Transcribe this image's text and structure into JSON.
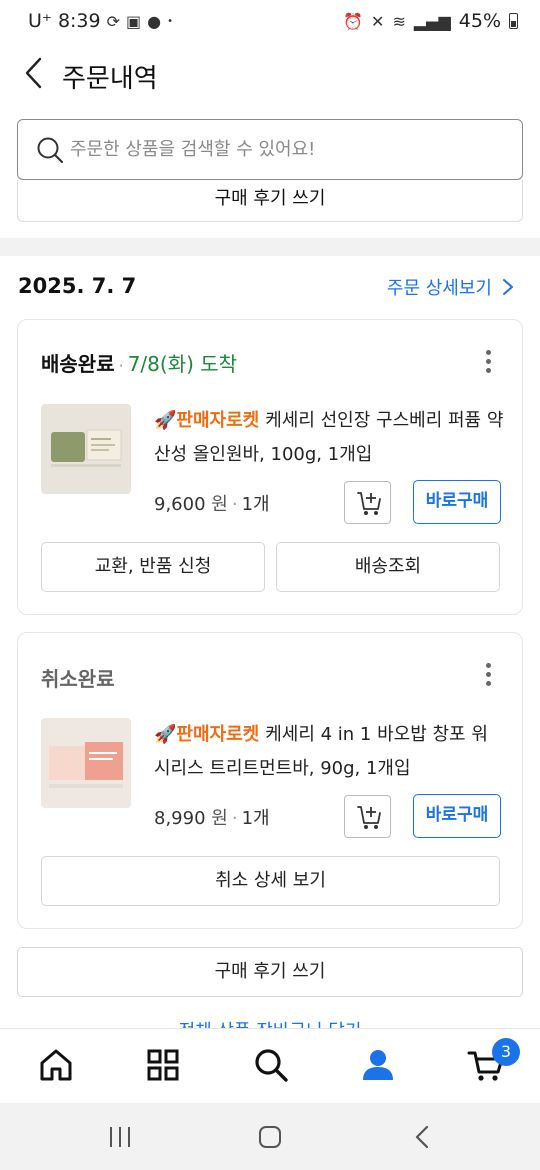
{
  "status_bar": {
    "carrier": "U⁺",
    "time": "8:39",
    "battery": "45%"
  },
  "header": {
    "title": "주문내역"
  },
  "search": {
    "placeholder": "주문한 상품을 검색할 수 있어요!"
  },
  "previous_order": {
    "review_label": "구매 후기 쓰기"
  },
  "order_group": {
    "date": "2025. 7. 7",
    "detail_link": "주문 상세보기"
  },
  "orders": [
    {
      "status": "배송완료",
      "arrival": "7/8(화) 도착",
      "badge": "🚀판매자로켓",
      "product_name": "케세리 선인장 구스베리 퍼퓸 약산성 올인원바, 100g, 1개입",
      "price": "9,600",
      "unit": "원",
      "qty": "1개",
      "buy_label": "바로구매",
      "action_left": "교환, 반품 신청",
      "action_right": "배송조회"
    },
    {
      "status": "취소완료",
      "badge": "🚀판매자로켓",
      "product_name": "케세리 4 in 1 바오밥 창포 워시리스 트리트먼트바, 90g, 1개입",
      "price": "8,990",
      "unit": "원",
      "qty": "1개",
      "buy_label": "바로구매",
      "action_full": "취소 상세 보기"
    }
  ],
  "review_button": "구매 후기 쓰기",
  "partial_link": "전체 상품 장바구니 담기",
  "bottom_nav": {
    "cart_count": "3",
    "active_color": "#1a73e8"
  },
  "colors": {
    "accent": "#1a73e8",
    "rocket": "#f26b0f",
    "delivered": "#1b8a3a"
  }
}
